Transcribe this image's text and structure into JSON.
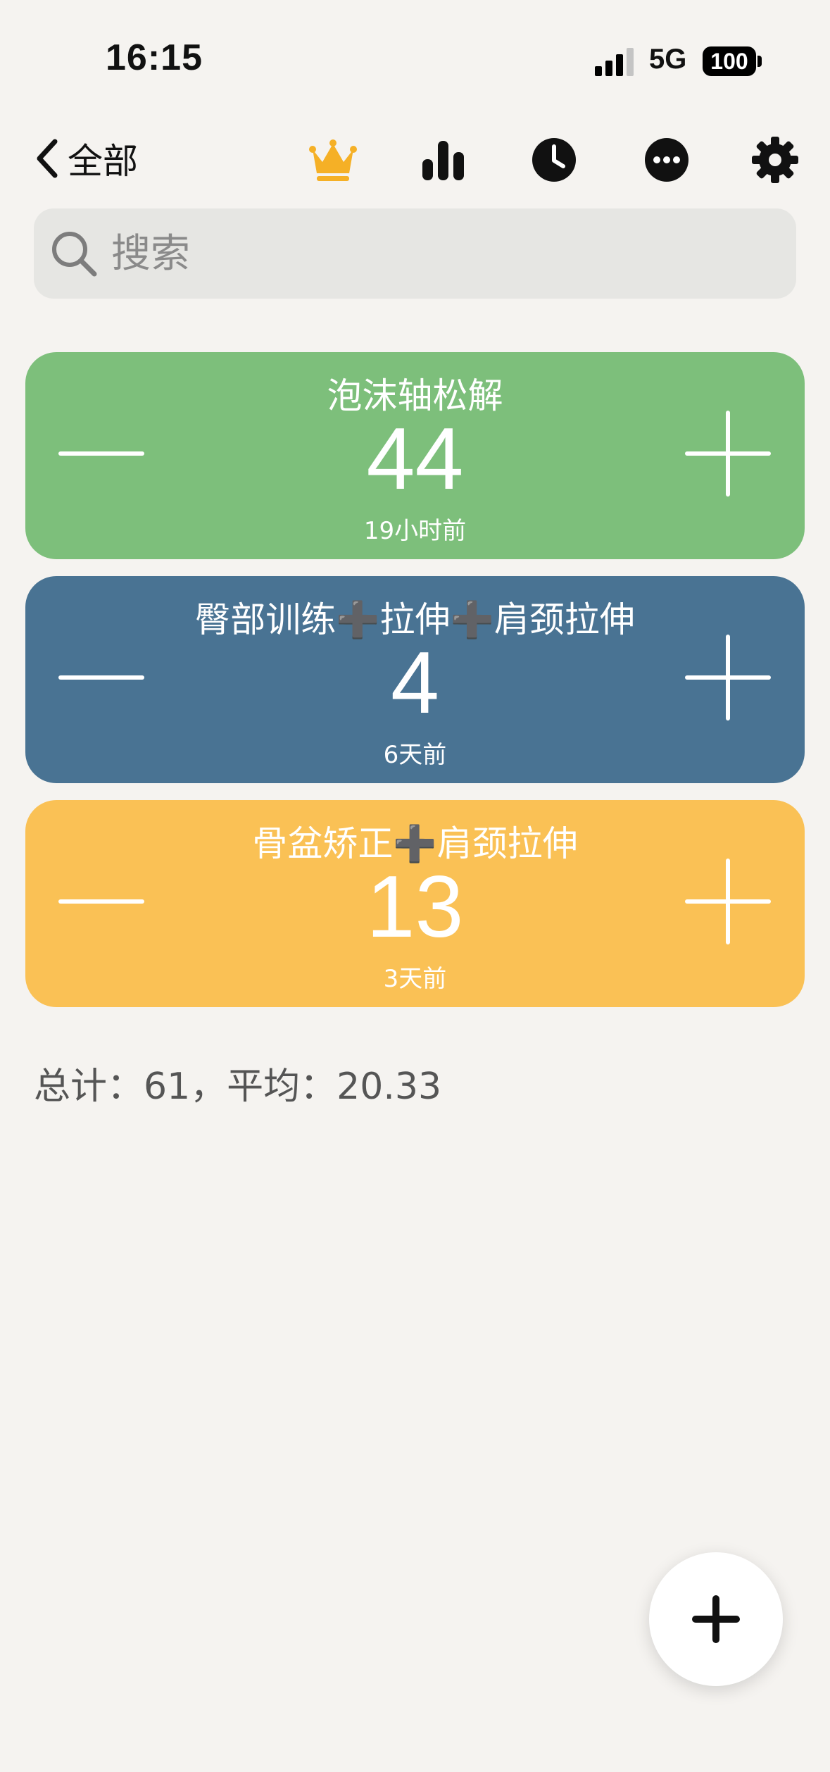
{
  "status_bar": {
    "time": "16:15",
    "network": "5G",
    "battery": "100"
  },
  "nav": {
    "back_label": "全部",
    "icons": [
      "crown-icon",
      "bar-chart-icon",
      "clock-icon",
      "more-icon",
      "gear-icon"
    ],
    "crown_color": "#f5b026"
  },
  "search": {
    "placeholder": "搜索",
    "value": ""
  },
  "counters": [
    {
      "title": "泡沫轴松解",
      "count": "44",
      "time": "19小时前",
      "color": "#7dbf7b"
    },
    {
      "title": "臀部训练➕拉伸➕肩颈拉伸",
      "count": "4",
      "time": "6天前",
      "color": "#497393"
    },
    {
      "title": "骨盆矫正➕肩颈拉伸",
      "count": "13",
      "time": "3天前",
      "color": "#fac155"
    }
  ],
  "summary": "总计：61，平均：20.33"
}
